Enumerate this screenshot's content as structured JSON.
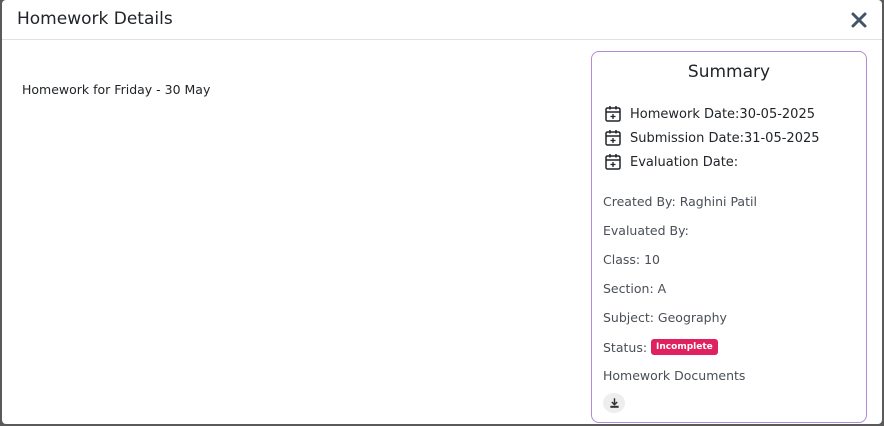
{
  "header": {
    "title": "Homework Details"
  },
  "main": {
    "description": "Homework for Friday - 30 May"
  },
  "summary": {
    "title": "Summary",
    "homework_date": "Homework Date:30-05-2025",
    "submission_date": "Submission Date:31-05-2025",
    "evaluation_date": "Evaluation Date:",
    "created_by": "Created By: Raghini Patil",
    "evaluated_by": "Evaluated By:",
    "class": "Class: 10",
    "section": "Section: A",
    "subject": "Subject: Geography",
    "status_label": "Status:",
    "status_value": "Incomplete",
    "documents_label": "Homework Documents"
  },
  "icons": {
    "close": "close-icon",
    "calendar": "calendar-plus-icon",
    "download": "download-icon"
  },
  "colors": {
    "card_border": "#b48ad6",
    "status_badge": "#e0215f",
    "close_icon": "#44546a"
  }
}
